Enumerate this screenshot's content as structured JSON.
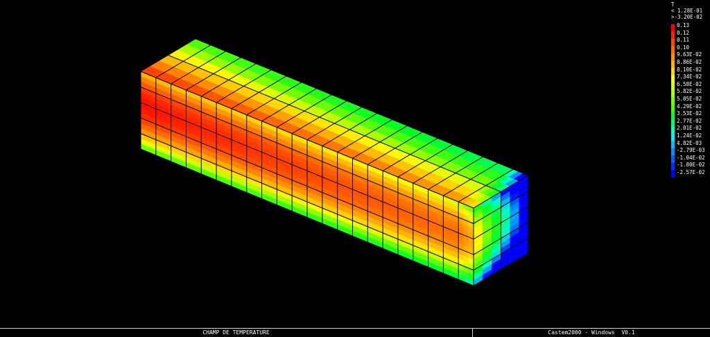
{
  "window": {
    "app_title": "Castem2000 - Windows  V0.1"
  },
  "plot": {
    "title": "CHAMP DE TEMPERATURE",
    "object": "3D hexahedral mesh bar, isometric view, colored temperature field",
    "mesh": {
      "length_elements": 22,
      "height_elements": 5,
      "depth_elements": 2
    }
  },
  "legend": {
    "component": "T",
    "max_line": "< 1.28E-01",
    "min_line": ">-3.20E-02",
    "levels": [
      {
        "label": "0.13",
        "color": "#ff0000"
      },
      {
        "label": "0.12",
        "color": "#ff2400"
      },
      {
        "label": "0.11",
        "color": "#ff4800"
      },
      {
        "label": "0.10",
        "color": "#ff6c00"
      },
      {
        "label": "9.63E-02",
        "color": "#ff9000"
      },
      {
        "label": "8.86E-02",
        "color": "#ffb400"
      },
      {
        "label": "8.10E-02",
        "color": "#ffd800"
      },
      {
        "label": "7.34E-02",
        "color": "#fffc00"
      },
      {
        "label": "6.58E-02",
        "color": "#d8ff00"
      },
      {
        "label": "5.82E-02",
        "color": "#a8ff00"
      },
      {
        "label": "5.05E-02",
        "color": "#78ff00"
      },
      {
        "label": "4.29E-02",
        "color": "#48ff00"
      },
      {
        "label": "3.53E-02",
        "color": "#00ff30"
      },
      {
        "label": "2.77E-02",
        "color": "#00ff78"
      },
      {
        "label": "2.01E-02",
        "color": "#00ffc0"
      },
      {
        "label": "1.24E-02",
        "color": "#00f0ff"
      },
      {
        "label": "4.82E-03",
        "color": "#00c0ff"
      },
      {
        "label": "-2.79E-03",
        "color": "#0090ff"
      },
      {
        "label": "-1.04E-02",
        "color": "#0060ff"
      },
      {
        "label": "-1.80E-02",
        "color": "#0030ff"
      },
      {
        "label": "-2.57E-02",
        "color": "#0000ff"
      }
    ]
  },
  "colors": {
    "background": "#000000",
    "grid_lines": "#000000",
    "text": "#ffffff"
  }
}
